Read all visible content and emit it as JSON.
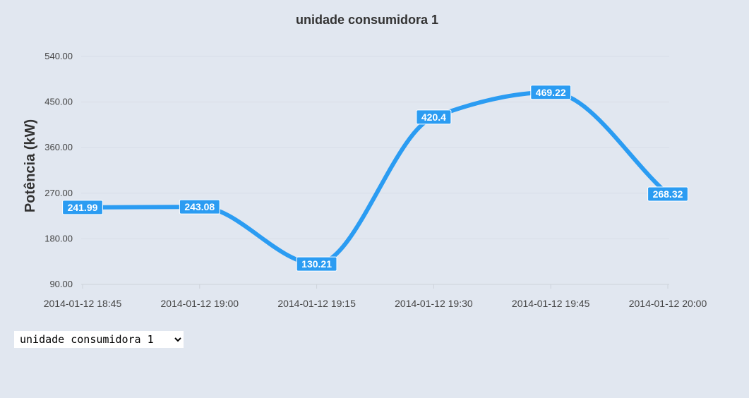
{
  "chart_data": {
    "type": "line",
    "title": "unidade consumidora 1",
    "xlabel": "",
    "ylabel": "Potência (kW)",
    "ylim": [
      90,
      540
    ],
    "yticks": [
      "90.00",
      "180.00",
      "270.00",
      "360.00",
      "450.00",
      "540.00"
    ],
    "categories": [
      "2014-01-12 18:45",
      "2014-01-12 19:00",
      "2014-01-12 19:15",
      "2014-01-12 19:30",
      "2014-01-12 19:45",
      "2014-01-12 20:00"
    ],
    "series": [
      {
        "values": [
          241.99,
          243.08,
          130.21,
          420.4,
          469.22,
          268.32
        ],
        "labels": [
          "241.99",
          "243.08",
          "130.21",
          "420.4",
          "469.22",
          "268.32"
        ],
        "color": "#2b9cf2"
      }
    ],
    "grid": true,
    "smooth": true
  },
  "selector": {
    "options": [
      "unidade consumidora 1"
    ],
    "selected": "unidade consumidora 1"
  }
}
